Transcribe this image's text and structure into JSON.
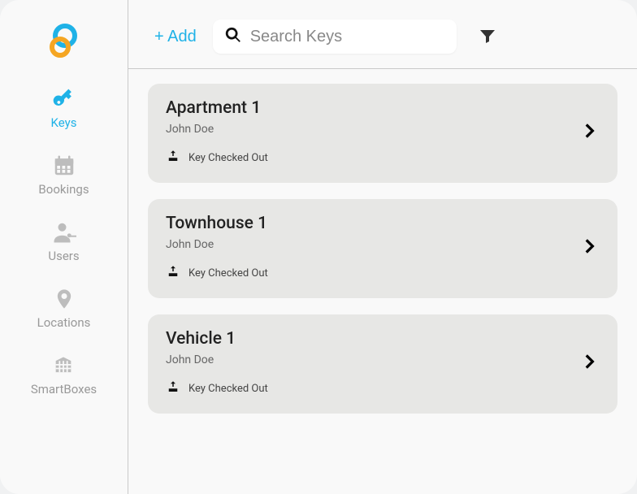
{
  "toolbar": {
    "add_label": "+ Add",
    "search_placeholder": "Search Keys"
  },
  "sidebar": {
    "items": [
      {
        "id": "keys",
        "label": "Keys",
        "active": true
      },
      {
        "id": "bookings",
        "label": "Bookings",
        "active": false
      },
      {
        "id": "users",
        "label": "Users",
        "active": false
      },
      {
        "id": "locations",
        "label": "Locations",
        "active": false
      },
      {
        "id": "smartboxes",
        "label": "SmartBoxes",
        "active": false
      }
    ]
  },
  "keys": [
    {
      "title": "Apartment 1",
      "owner": "John Doe",
      "status": "Key Checked Out"
    },
    {
      "title": "Townhouse 1",
      "owner": "John Doe",
      "status": "Key Checked Out"
    },
    {
      "title": "Vehicle 1",
      "owner": "John Doe",
      "status": "Key Checked Out"
    }
  ],
  "colors": {
    "accent": "#1fb2e7",
    "accent2": "#f5a623",
    "card_bg": "#e7e7e5",
    "muted": "#999"
  }
}
